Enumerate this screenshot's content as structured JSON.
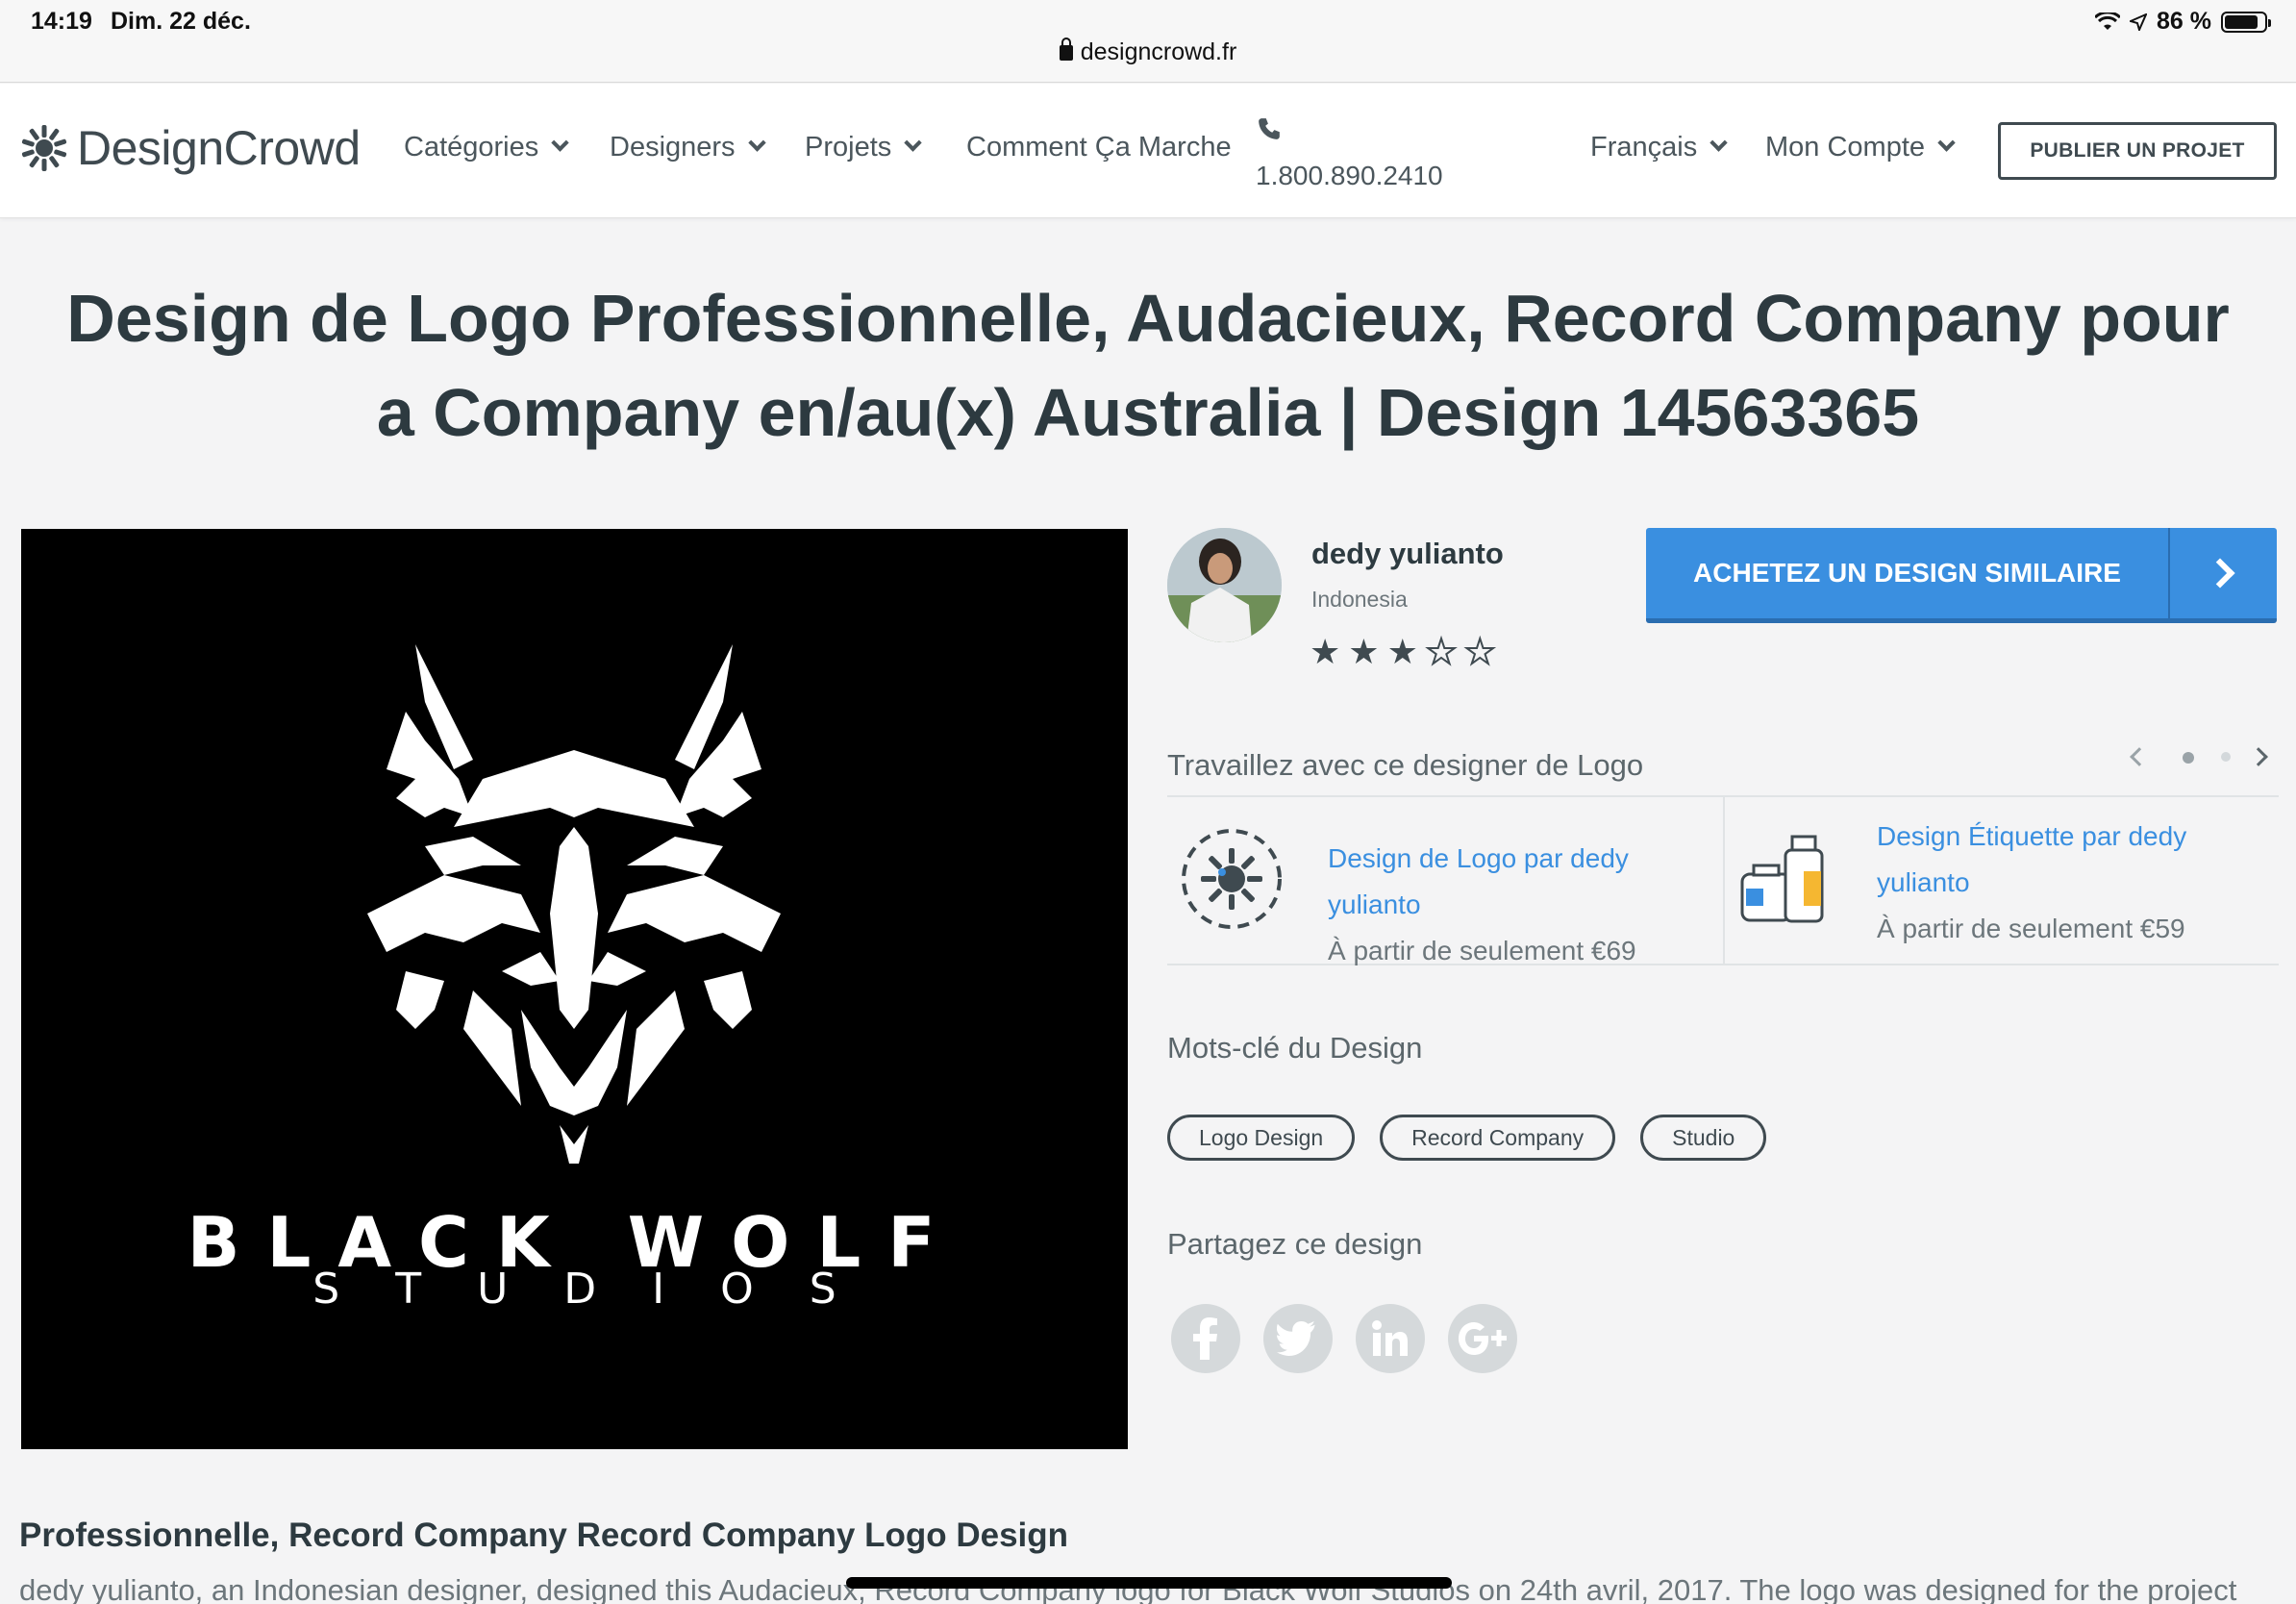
{
  "statusbar": {
    "time": "14:19",
    "date": "Dim. 22 déc.",
    "url": "designcrowd.fr",
    "battery": "86 %",
    "battery_level": 0.86
  },
  "nav": {
    "brand": "DesignCrowd",
    "items": [
      {
        "label": "Catégories"
      },
      {
        "label": "Designers"
      },
      {
        "label": "Projets"
      },
      {
        "label": "Comment Ça Marche"
      }
    ],
    "phone": "1.800.890.2410",
    "language": "Français",
    "account": "Mon Compte",
    "publish": "PUBLIER UN PROJET"
  },
  "page": {
    "title": "Design de Logo Professionnelle, Audacieux, Record Company pour a Company en/au(x) Australia | Design 14563365"
  },
  "design": {
    "brand_line1": "BLACK WOLF",
    "brand_line2": "STUDIOS"
  },
  "designer": {
    "name": "dedy yulianto",
    "country": "Indonesia",
    "rating": 3,
    "rating_max": 5
  },
  "buy_button": "ACHETEZ UN DESIGN SIMILAIRE",
  "work_with": {
    "title": "Travaillez avec ce designer de Logo",
    "services": [
      {
        "link": "Design de Logo par dedy yulianto",
        "price": "À partir de seulement €69",
        "icon": "logo-design-icon"
      },
      {
        "link": "Design Étiquette par dedy yulianto",
        "price": "À partir de seulement €59",
        "icon": "label-design-icon"
      }
    ]
  },
  "keywords": {
    "title": "Mots-clé du Design",
    "tags": [
      "Logo Design",
      "Record Company",
      "Studio"
    ]
  },
  "share": {
    "title": "Partagez ce design",
    "networks": [
      "facebook-icon",
      "twitter-icon",
      "linkedin-icon",
      "google-plus-icon"
    ]
  },
  "description": {
    "title": "Professionnelle, Record Company Record Company Logo Design",
    "text": "dedy yulianto, an Indonesian designer, designed this Audacieux, Record Company logo for Black Wolf Studios on 24th avril, 2017. The logo was designed for the project"
  },
  "colors": {
    "accent": "#3a8fe0",
    "text": "#2d3a40",
    "background": "#f4f4f5"
  }
}
